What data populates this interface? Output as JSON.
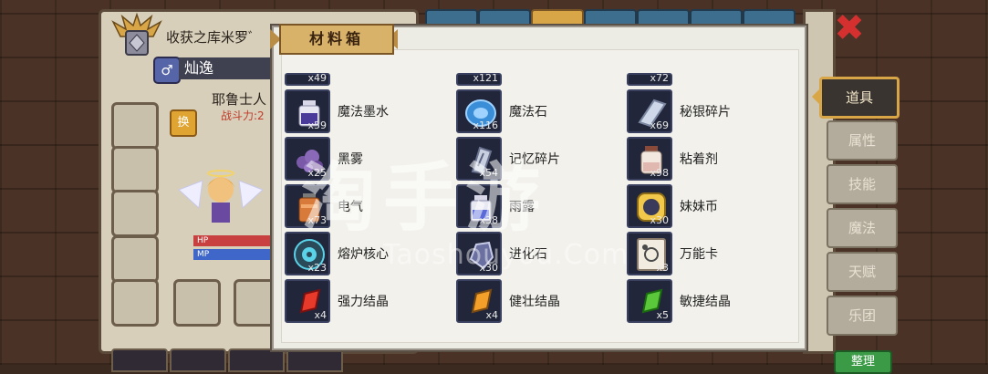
{
  "character": {
    "title": "收获之库米罗ﾞ",
    "name": "灿逸",
    "gender_symbol": "♂",
    "class_title": "耶鲁士人",
    "power_label": "战斗力:2",
    "swap_label": "换",
    "hp_label": "HP",
    "mp_label": "MP"
  },
  "popup": {
    "title": "材料箱",
    "partial_row": [
      {
        "qty": "x49"
      },
      {
        "qty": "x121"
      },
      {
        "qty": "x72"
      }
    ],
    "items": [
      {
        "name": "魔法墨水",
        "qty": "x59",
        "icon": "ink-bottle-icon"
      },
      {
        "name": "魔法石",
        "qty": "x116",
        "icon": "magic-stone-icon"
      },
      {
        "name": "秘银碎片",
        "qty": "x69",
        "icon": "mithril-shard-icon"
      },
      {
        "name": "黑雾",
        "qty": "x25",
        "icon": "black-mist-icon"
      },
      {
        "name": "记忆碎片",
        "qty": "x54",
        "icon": "memory-shard-icon"
      },
      {
        "name": "粘着剂",
        "qty": "x98",
        "icon": "adhesive-jar-icon"
      },
      {
        "name": "电气",
        "qty": "x73",
        "icon": "electric-canister-icon"
      },
      {
        "name": "雨露",
        "qty": "x38",
        "icon": "dew-bottle-icon"
      },
      {
        "name": "妹妹币",
        "qty": "x30",
        "icon": "sister-coin-icon"
      },
      {
        "name": "熔炉核心",
        "qty": "x23",
        "icon": "furnace-core-icon"
      },
      {
        "name": "进化石",
        "qty": "x30",
        "icon": "evolution-stone-icon"
      },
      {
        "name": "万能卡",
        "qty": "x3",
        "icon": "universal-card-icon"
      },
      {
        "name": "强力结晶",
        "qty": "x4",
        "icon": "red-crystal-icon"
      },
      {
        "name": "健壮结晶",
        "qty": "x4",
        "icon": "orange-crystal-icon"
      },
      {
        "name": "敏捷结晶",
        "qty": "x5",
        "icon": "green-crystal-icon"
      }
    ]
  },
  "side_tabs": [
    {
      "label": "道具",
      "active": true
    },
    {
      "label": "属性",
      "active": false
    },
    {
      "label": "技能",
      "active": false
    },
    {
      "label": "魔法",
      "active": false
    },
    {
      "label": "天赋",
      "active": false
    },
    {
      "label": "乐团",
      "active": false
    }
  ],
  "sort_label": "整理",
  "watermark": {
    "text": "淘手游",
    "url": "Taoshouyou.Com"
  },
  "colors": {
    "accent_gold": "#d8a646",
    "close_red": "#d43030",
    "slot_bg": "#22263a"
  }
}
